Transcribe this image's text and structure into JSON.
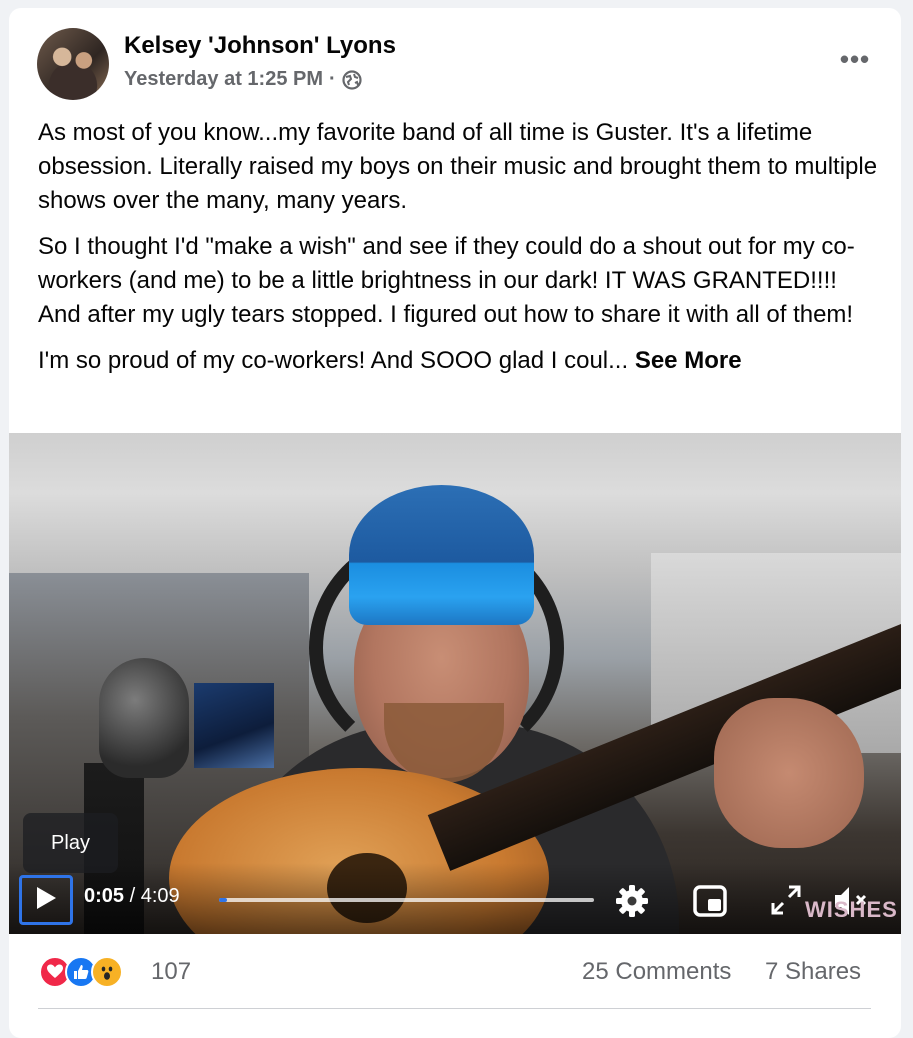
{
  "post": {
    "author": "Kelsey 'Johnson' Lyons",
    "timestamp": "Yesterday at 1:25 PM",
    "separator": "·",
    "privacy_icon": "globe-icon",
    "more_label": "•••",
    "paragraphs": [
      "As most of you know...my favorite band of all time is Guster. It's a lifetime obsession. Literally raised my boys on their music and brought them to multiple shows over the many, many years.",
      "So I thought I'd \"make a wish\" and see if they could do a shout out for my co-workers (and me) to be a little brightness in our dark! IT WAS GRANTED!!!! And after my ugly tears stopped. I figured out how to share it with all of them!",
      "I'm so proud of my co-workers! And SOOO glad I coul..."
    ],
    "see_more_label": "See More"
  },
  "video": {
    "tooltip": "Play",
    "current_time": "0:05",
    "time_separator": " / ",
    "duration": "4:09",
    "progress": 0.02,
    "watermark": "WISHES",
    "controls": [
      "play-icon",
      "settings-gear-icon",
      "picture-in-picture-icon",
      "fullscreen-icon",
      "mute-icon"
    ]
  },
  "footer": {
    "reaction_icons": [
      "love-icon",
      "like-icon",
      "wow-icon"
    ],
    "reaction_count": "107",
    "comments": "25 Comments",
    "shares": "7 Shares"
  },
  "colors": {
    "accent": "#2f74e8",
    "secondary_text": "#65676b",
    "love": "#f02849",
    "like": "#1877f2",
    "wow": "#f7b125"
  }
}
